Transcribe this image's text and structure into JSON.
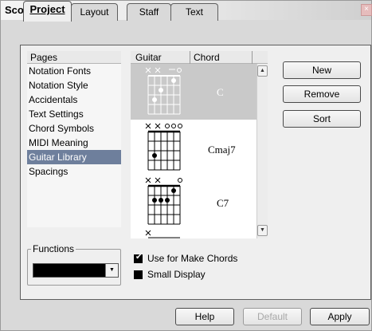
{
  "window": {
    "title": "Score Settings",
    "close_glyph": "×"
  },
  "tabs": [
    {
      "label": "Project",
      "active": true
    },
    {
      "label": "Layout",
      "active": false
    },
    {
      "label": "Staff",
      "active": false
    },
    {
      "label": "Text",
      "active": false
    }
  ],
  "pages": {
    "header": "Pages",
    "items": [
      "Notation Fonts",
      "Notation Style",
      "Accidentals",
      "Text Settings",
      "Chord Symbols",
      "MIDI Meaning",
      "Guitar Library",
      "Spacings"
    ],
    "selected": "Guitar Library"
  },
  "library": {
    "columns": [
      "Guitar",
      "Chord"
    ],
    "rows": [
      {
        "chord": "C",
        "selected": true
      },
      {
        "chord": "Cmaj7",
        "selected": false
      },
      {
        "chord": "C7",
        "selected": false
      }
    ]
  },
  "scrollbar": {
    "up_glyph": "▲",
    "down_glyph": "▼"
  },
  "buttons": {
    "new": "New",
    "remove": "Remove",
    "sort": "Sort",
    "help": "Help",
    "default": "Default",
    "apply": "Apply"
  },
  "functions": {
    "label": "Functions",
    "value": "",
    "arrow_glyph": "▼"
  },
  "options": {
    "use_for_make_chords": {
      "label": "Use for Make Chords",
      "checked": true
    },
    "small_display": {
      "label": "Small Display",
      "checked": false
    }
  },
  "colors": {
    "selection": "#6e7f9c",
    "library_selection": "#c9c9c9",
    "panel": "#efefef"
  }
}
